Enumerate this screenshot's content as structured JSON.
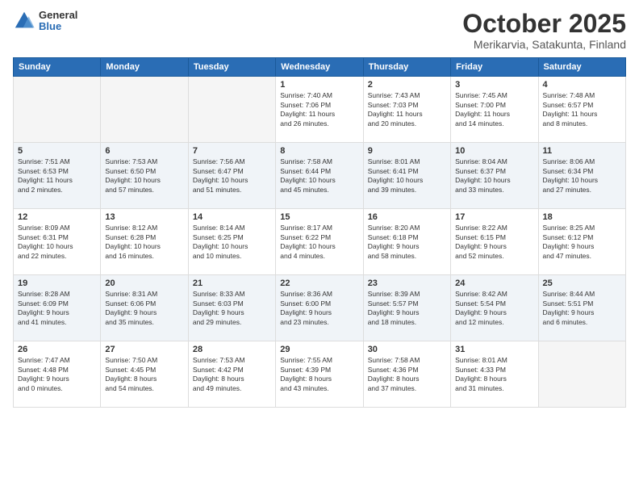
{
  "header": {
    "logo_general": "General",
    "logo_blue": "Blue",
    "title": "October 2025",
    "subtitle": "Merikarvia, Satakunta, Finland"
  },
  "weekdays": [
    "Sunday",
    "Monday",
    "Tuesday",
    "Wednesday",
    "Thursday",
    "Friday",
    "Saturday"
  ],
  "weeks": [
    [
      {
        "day": "",
        "info": ""
      },
      {
        "day": "",
        "info": ""
      },
      {
        "day": "",
        "info": ""
      },
      {
        "day": "1",
        "info": "Sunrise: 7:40 AM\nSunset: 7:06 PM\nDaylight: 11 hours\nand 26 minutes."
      },
      {
        "day": "2",
        "info": "Sunrise: 7:43 AM\nSunset: 7:03 PM\nDaylight: 11 hours\nand 20 minutes."
      },
      {
        "day": "3",
        "info": "Sunrise: 7:45 AM\nSunset: 7:00 PM\nDaylight: 11 hours\nand 14 minutes."
      },
      {
        "day": "4",
        "info": "Sunrise: 7:48 AM\nSunset: 6:57 PM\nDaylight: 11 hours\nand 8 minutes."
      }
    ],
    [
      {
        "day": "5",
        "info": "Sunrise: 7:51 AM\nSunset: 6:53 PM\nDaylight: 11 hours\nand 2 minutes."
      },
      {
        "day": "6",
        "info": "Sunrise: 7:53 AM\nSunset: 6:50 PM\nDaylight: 10 hours\nand 57 minutes."
      },
      {
        "day": "7",
        "info": "Sunrise: 7:56 AM\nSunset: 6:47 PM\nDaylight: 10 hours\nand 51 minutes."
      },
      {
        "day": "8",
        "info": "Sunrise: 7:58 AM\nSunset: 6:44 PM\nDaylight: 10 hours\nand 45 minutes."
      },
      {
        "day": "9",
        "info": "Sunrise: 8:01 AM\nSunset: 6:41 PM\nDaylight: 10 hours\nand 39 minutes."
      },
      {
        "day": "10",
        "info": "Sunrise: 8:04 AM\nSunset: 6:37 PM\nDaylight: 10 hours\nand 33 minutes."
      },
      {
        "day": "11",
        "info": "Sunrise: 8:06 AM\nSunset: 6:34 PM\nDaylight: 10 hours\nand 27 minutes."
      }
    ],
    [
      {
        "day": "12",
        "info": "Sunrise: 8:09 AM\nSunset: 6:31 PM\nDaylight: 10 hours\nand 22 minutes."
      },
      {
        "day": "13",
        "info": "Sunrise: 8:12 AM\nSunset: 6:28 PM\nDaylight: 10 hours\nand 16 minutes."
      },
      {
        "day": "14",
        "info": "Sunrise: 8:14 AM\nSunset: 6:25 PM\nDaylight: 10 hours\nand 10 minutes."
      },
      {
        "day": "15",
        "info": "Sunrise: 8:17 AM\nSunset: 6:22 PM\nDaylight: 10 hours\nand 4 minutes."
      },
      {
        "day": "16",
        "info": "Sunrise: 8:20 AM\nSunset: 6:18 PM\nDaylight: 9 hours\nand 58 minutes."
      },
      {
        "day": "17",
        "info": "Sunrise: 8:22 AM\nSunset: 6:15 PM\nDaylight: 9 hours\nand 52 minutes."
      },
      {
        "day": "18",
        "info": "Sunrise: 8:25 AM\nSunset: 6:12 PM\nDaylight: 9 hours\nand 47 minutes."
      }
    ],
    [
      {
        "day": "19",
        "info": "Sunrise: 8:28 AM\nSunset: 6:09 PM\nDaylight: 9 hours\nand 41 minutes."
      },
      {
        "day": "20",
        "info": "Sunrise: 8:31 AM\nSunset: 6:06 PM\nDaylight: 9 hours\nand 35 minutes."
      },
      {
        "day": "21",
        "info": "Sunrise: 8:33 AM\nSunset: 6:03 PM\nDaylight: 9 hours\nand 29 minutes."
      },
      {
        "day": "22",
        "info": "Sunrise: 8:36 AM\nSunset: 6:00 PM\nDaylight: 9 hours\nand 23 minutes."
      },
      {
        "day": "23",
        "info": "Sunrise: 8:39 AM\nSunset: 5:57 PM\nDaylight: 9 hours\nand 18 minutes."
      },
      {
        "day": "24",
        "info": "Sunrise: 8:42 AM\nSunset: 5:54 PM\nDaylight: 9 hours\nand 12 minutes."
      },
      {
        "day": "25",
        "info": "Sunrise: 8:44 AM\nSunset: 5:51 PM\nDaylight: 9 hours\nand 6 minutes."
      }
    ],
    [
      {
        "day": "26",
        "info": "Sunrise: 7:47 AM\nSunset: 4:48 PM\nDaylight: 9 hours\nand 0 minutes."
      },
      {
        "day": "27",
        "info": "Sunrise: 7:50 AM\nSunset: 4:45 PM\nDaylight: 8 hours\nand 54 minutes."
      },
      {
        "day": "28",
        "info": "Sunrise: 7:53 AM\nSunset: 4:42 PM\nDaylight: 8 hours\nand 49 minutes."
      },
      {
        "day": "29",
        "info": "Sunrise: 7:55 AM\nSunset: 4:39 PM\nDaylight: 8 hours\nand 43 minutes."
      },
      {
        "day": "30",
        "info": "Sunrise: 7:58 AM\nSunset: 4:36 PM\nDaylight: 8 hours\nand 37 minutes."
      },
      {
        "day": "31",
        "info": "Sunrise: 8:01 AM\nSunset: 4:33 PM\nDaylight: 8 hours\nand 31 minutes."
      },
      {
        "day": "",
        "info": ""
      }
    ]
  ]
}
